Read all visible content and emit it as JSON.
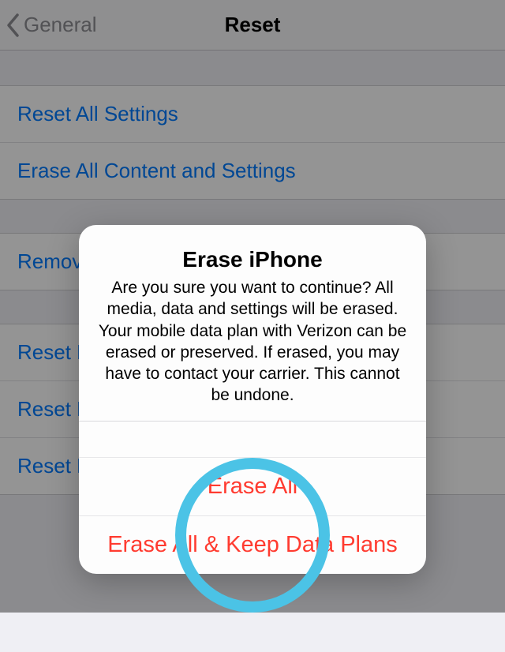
{
  "nav": {
    "back_label": "General",
    "title": "Reset"
  },
  "rows": {
    "reset_all": "Reset All Settings",
    "erase_all": "Erase All Content and Settings",
    "remove": "Remove",
    "reset_k": "Reset K",
    "reset_h": "Reset H",
    "reset_l": "Reset L"
  },
  "alert": {
    "title": "Erase iPhone",
    "message": "Are you sure you want to continue? All media, data and settings will be erased. Your mobile data plan with Verizon can be erased or preserved. If erased, you may have to contact your carrier.\nThis cannot be undone.",
    "action_erase_all": "Erase All",
    "action_erase_keep": "Erase All & Keep Data Plans"
  }
}
